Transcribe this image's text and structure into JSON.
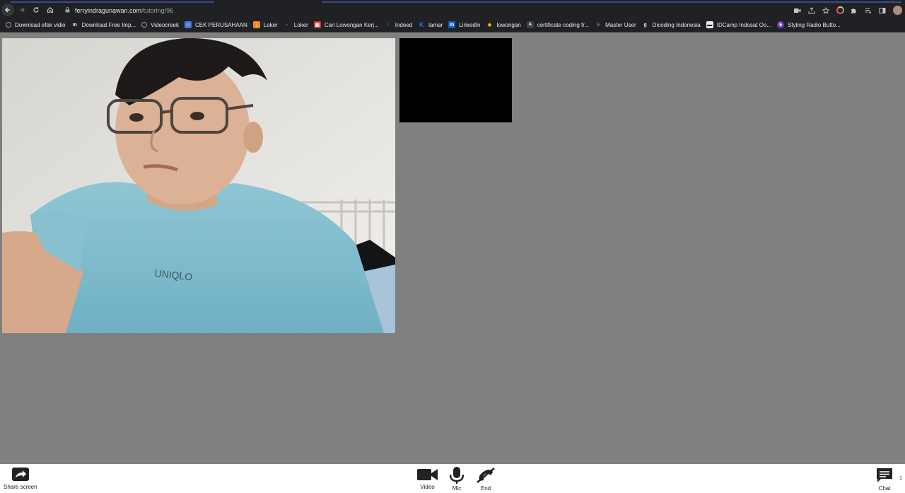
{
  "browser": {
    "url_host": "ferryindragunawan.com",
    "url_path": "/tutoring/96",
    "nav": {
      "back_icon": "arrow-left-icon",
      "forward_icon": "arrow-right-icon",
      "reload_icon": "reload-icon",
      "home_icon": "home-icon"
    },
    "bookmarks": [
      {
        "label": "Download efek vidio",
        "icon": "globe-icon",
        "color": "#9aa0a6"
      },
      {
        "label": "Download Free Imp...",
        "icon": "m-icon",
        "color": "#202124"
      },
      {
        "label": "Videocreek",
        "icon": "globe-icon",
        "color": "#9aa0a6"
      },
      {
        "label": "CEK PERUSAHAAN",
        "icon": "building-icon",
        "color": "#4a7bd0"
      },
      {
        "label": "Loker",
        "icon": "download-icon",
        "color": "#f08a24"
      },
      {
        "label": "Loker",
        "icon": "glassdoor-icon",
        "color": "#e0245e"
      },
      {
        "label": "Cari Lowongan Kerj...",
        "icon": "job-icon",
        "color": "#d93025"
      },
      {
        "label": "Indeed",
        "icon": "indeed-icon",
        "color": "#2164f3"
      },
      {
        "label": "lamar",
        "icon": "k-icon",
        "color": "#1a73e8"
      },
      {
        "label": "LinkedIn",
        "icon": "linkedin-icon",
        "color": "#0a66c2"
      },
      {
        "label": "lowongan",
        "icon": "blip-icon",
        "color": "#f4b400"
      },
      {
        "label": "certificate coding fr...",
        "icon": "code-icon",
        "color": "#3c4043"
      },
      {
        "label": "Master User",
        "icon": "stripe-icon",
        "color": "#7b68ee"
      },
      {
        "label": "Dicoding Indonesia",
        "icon": "dicoding-icon",
        "color": "#9aa0a6"
      },
      {
        "label": "IDCamp Indosat Oo...",
        "icon": "page-icon",
        "color": "#e8eaed"
      },
      {
        "label": "Styling Radio Butto...",
        "icon": "six-icon",
        "color": "#6a3cc8"
      }
    ]
  },
  "videos": {
    "main_alt": "local-video",
    "remote_alt": "remote-video"
  },
  "controls": {
    "share_label": "Share screen",
    "video_label": "Video",
    "mic_label": "Mic",
    "end_label": "End",
    "chat_label": "Chat",
    "chat_count": "1"
  }
}
